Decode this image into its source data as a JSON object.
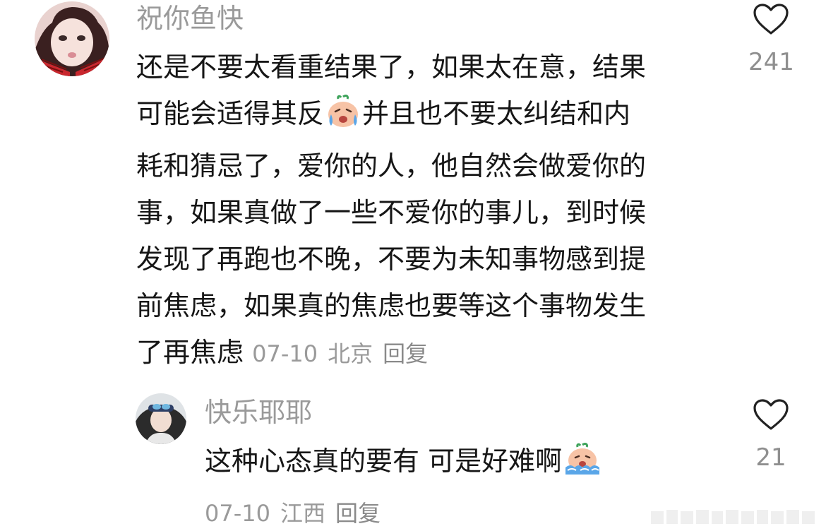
{
  "comment_1": {
    "username": "祝你鱼快",
    "text_lines": [
      "还是不要太看重结果了，如果太在意，结果",
      "可能会适得其反",
      "并且也不要太纠结和内",
      "耗和猜忌了，爱你的人，他自然会做爱你的",
      "事，如果真做了一些不爱你的事儿，到时候",
      "发现了再跑也不晚，不要为未知事物感到提",
      "前焦虑，如果真的焦虑也要等这个事物发生",
      "了再焦虑"
    ],
    "date": "07-10",
    "location": "北京",
    "reply": "回复",
    "likes": "241"
  },
  "comment_2": {
    "username": "快乐耶耶",
    "text": "这种心态真的要有  可是好难啊",
    "date": "07-10",
    "location": "江西",
    "reply": "回复",
    "likes": "21"
  },
  "icons": {
    "like": "heart-outline-icon",
    "emoji_1": "crying-face-emoji",
    "emoji_2": "sobbing-face-emoji"
  },
  "colors": {
    "username": "#9a9a9a",
    "text": "#161616",
    "meta": "#9a9a9a"
  }
}
